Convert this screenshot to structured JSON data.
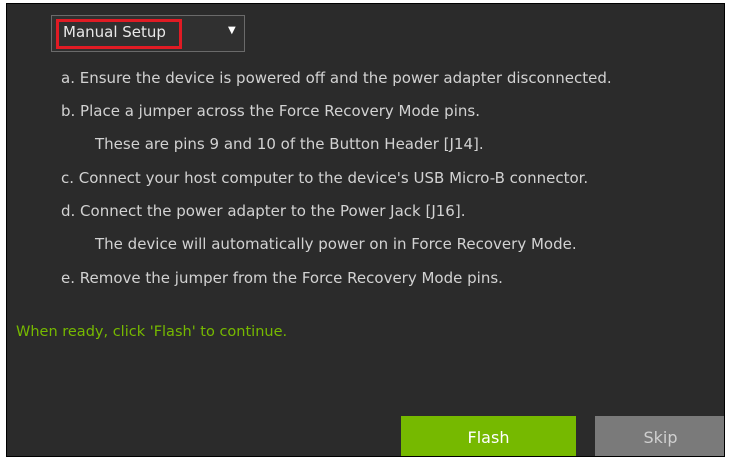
{
  "setup_mode": {
    "selected": "Manual Setup",
    "arrow_icon": "caret-down-icon"
  },
  "instructions": [
    "a. Ensure the device is powered off and the power adapter disconnected.",
    "b. Place a jumper across the Force Recovery Mode pins.",
    "These are pins 9 and 10 of the Button Header [J14].",
    "c. Connect your host computer to the device's USB Micro-B connector.",
    "d. Connect the power adapter to the Power Jack [J16].",
    "The device will automatically power on in Force Recovery Mode.",
    "e. Remove the jumper from the Force Recovery Mode pins."
  ],
  "ready_message": "When ready, click 'Flash' to continue.",
  "buttons": {
    "flash_label": "Flash",
    "skip_label": "Skip"
  },
  "colors": {
    "accent_green": "#76b900",
    "highlight_red": "#e01b24",
    "background": "#2b2b2b"
  }
}
